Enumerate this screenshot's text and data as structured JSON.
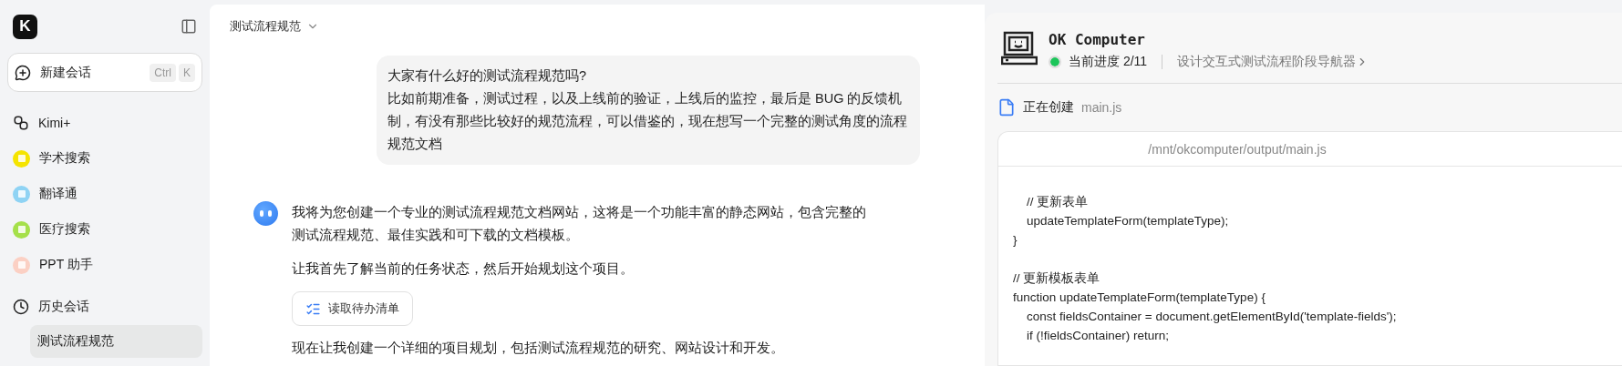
{
  "sidebar": {
    "logo": "K",
    "new_chat": {
      "label": "新建会话",
      "keys": [
        "Ctrl",
        "K"
      ]
    },
    "items": [
      {
        "label": "Kimi+",
        "kind": "link"
      },
      {
        "label": "学术搜索",
        "kind": "app",
        "color": "#f5e400"
      },
      {
        "label": "翻译通",
        "kind": "app",
        "color": "#8fd3f4"
      },
      {
        "label": "医疗搜索",
        "kind": "app",
        "color": "#a5e04a"
      },
      {
        "label": "PPT 助手",
        "kind": "app",
        "color": "#fbd0c4"
      }
    ],
    "history": {
      "label": "历史会话",
      "items": [
        {
          "label": "测试流程规范",
          "selected": true
        }
      ]
    }
  },
  "chat": {
    "title": "测试流程规范",
    "user_message": [
      "大家有什么好的测试流程规范吗?",
      "比如前期准备，测试过程，以及上线前的验证，上线后的监控，最后是 BUG 的反馈机制，有没有那些比较好的规范流程，可以借鉴的，现在想写一个完整的测试角度的流程规范文档"
    ],
    "assistant": [
      {
        "kind": "text",
        "text": "我将为您创建一个专业的测试流程规范文档网站，这将是一个功能丰富的静态网站，包含完整的测试流程规范、最佳实践和可下载的文档模板。"
      },
      {
        "kind": "text",
        "text": "让我首先了解当前的任务状态，然后开始规划这个项目。"
      },
      {
        "kind": "tool",
        "text": "读取待办清单"
      },
      {
        "kind": "text",
        "text": "现在让我创建一个详细的项目规划，包括测试流程规范的研究、网站设计和开发。"
      }
    ]
  },
  "computer": {
    "title": "OK Computer",
    "progress": "当前进度 2/11",
    "step": "设计交互式测试流程阶段导航器",
    "action": "正在创建",
    "file": "main.js",
    "path": "/mnt/okcomputer/output/main.js",
    "code": [
      {
        "lines": [
          "    // 更新表单",
          "    updateTemplateForm(templateType);",
          "}"
        ]
      },
      {
        "lines": [
          "// 更新模板表单",
          "function updateTemplateForm(templateType) {",
          "    const fieldsContainer = document.getElementById('template-fields');",
          "    if (!fieldsContainer) return;"
        ]
      }
    ]
  }
}
